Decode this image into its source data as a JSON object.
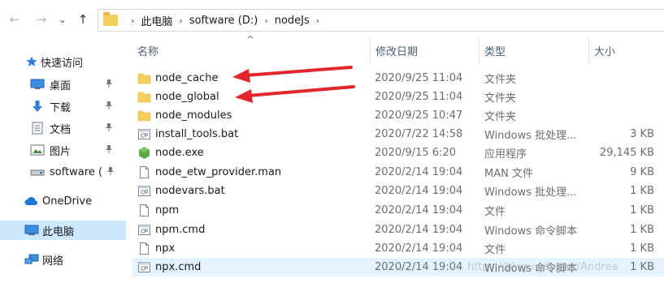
{
  "address_bar": {
    "back_glyph": "←",
    "forward_glyph": "→",
    "recent_glyph": "⌄",
    "up_glyph": "↑",
    "breadcrumbs": [
      "此电脑",
      "software (D:)",
      "nodeJs"
    ],
    "separator": "›"
  },
  "nav_pane": {
    "items": [
      {
        "label": "快速访问",
        "icon": "star-icon",
        "pinned": false
      },
      {
        "label": "桌面",
        "icon": "desktop-icon",
        "pinned": true
      },
      {
        "label": "下载",
        "icon": "download-icon",
        "pinned": true
      },
      {
        "label": "文档",
        "icon": "document-icon",
        "pinned": true
      },
      {
        "label": "图片",
        "icon": "pictures-icon",
        "pinned": true
      },
      {
        "label": "software (",
        "icon": "drive-icon",
        "pinned": true
      },
      {
        "label": "OneDrive",
        "icon": "cloud-icon",
        "pinned": false
      },
      {
        "label": "此电脑",
        "icon": "computer-icon",
        "pinned": false,
        "selected": true
      },
      {
        "label": "网络",
        "icon": "network-icon",
        "pinned": false
      }
    ],
    "pin_glyph": "📌"
  },
  "columns": {
    "name": "名称",
    "date": "修改日期",
    "type": "类型",
    "size": "大小",
    "sort_glyph": "^"
  },
  "files": [
    {
      "name": "node_cache",
      "date": "2020/9/25 11:04",
      "type": "文件夹",
      "size": "",
      "icon": "folder-icon"
    },
    {
      "name": "node_global",
      "date": "2020/9/25 11:04",
      "type": "文件夹",
      "size": "",
      "icon": "folder-icon"
    },
    {
      "name": "node_modules",
      "date": "2020/9/25 10:47",
      "type": "文件夹",
      "size": "",
      "icon": "folder-icon"
    },
    {
      "name": "install_tools.bat",
      "date": "2020/7/22 14:58",
      "type": "Windows 批处理...",
      "size": "3 KB",
      "icon": "batch-file-icon"
    },
    {
      "name": "node.exe",
      "date": "2020/9/15 6:20",
      "type": "应用程序",
      "size": "29,145 KB",
      "icon": "node-exe-icon"
    },
    {
      "name": "node_etw_provider.man",
      "date": "2020/2/14 19:04",
      "type": "MAN 文件",
      "size": "9 KB",
      "icon": "file-icon"
    },
    {
      "name": "nodevars.bat",
      "date": "2020/2/14 19:04",
      "type": "Windows 批处理...",
      "size": "1 KB",
      "icon": "batch-file-icon"
    },
    {
      "name": "npm",
      "date": "2020/2/14 19:04",
      "type": "文件",
      "size": "1 KB",
      "icon": "file-icon"
    },
    {
      "name": "npm.cmd",
      "date": "2020/2/14 19:04",
      "type": "Windows 命令脚本",
      "size": "1 KB",
      "icon": "batch-file-icon"
    },
    {
      "name": "npx",
      "date": "2020/2/14 19:04",
      "type": "文件",
      "size": "1 KB",
      "icon": "file-icon"
    },
    {
      "name": "npx.cmd",
      "date": "2020/2/14 19:04",
      "type": "Windows 命令脚本",
      "size": "1 KB",
      "icon": "batch-file-icon",
      "highlighted": true
    }
  ],
  "watermark": "https://blog.csdn.net/Andrea",
  "colors": {
    "folder": "#f4cf5c",
    "selected_nav": "#cce8ff",
    "hover_row": "#e5f3ff",
    "arrow": "#e3262b",
    "header_text": "#4c607a"
  }
}
